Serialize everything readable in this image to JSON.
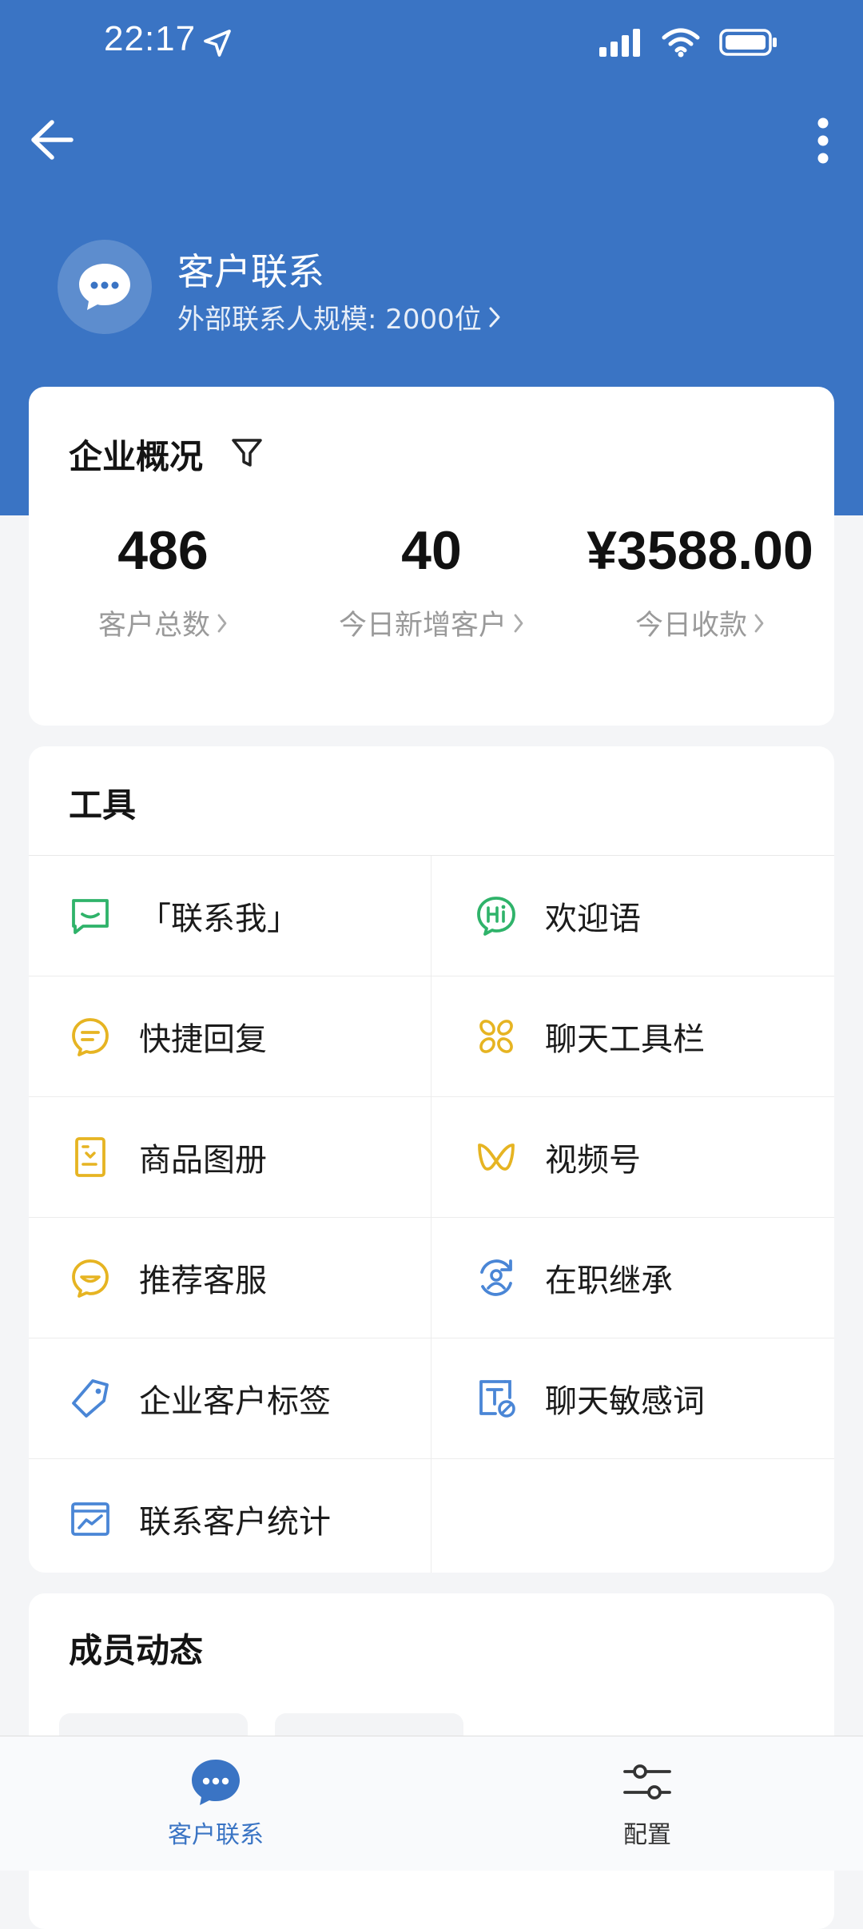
{
  "status_bar": {
    "time": "22:17",
    "icons": [
      "location-arrow-icon",
      "signal-icon",
      "wifi-icon",
      "battery-icon"
    ]
  },
  "header": {
    "app_name": "客户联系",
    "subtitle": "外部联系人规模: 2000位",
    "icons": [
      "back-arrow-icon",
      "more-vertical-icon",
      "chat-bubble-icon"
    ]
  },
  "overview": {
    "title": "企业概况",
    "stats": [
      {
        "value": "486",
        "label": "客户总数"
      },
      {
        "value": "40",
        "label": "今日新增客户"
      },
      {
        "value": "¥3588.00",
        "label": "今日收款"
      }
    ]
  },
  "tools": {
    "title": "工具",
    "items": [
      {
        "label": "「联系我」",
        "icon": "contact-me-icon",
        "color": "#2fb36a"
      },
      {
        "label": "欢迎语",
        "icon": "hi-greeting-icon",
        "color": "#2fb36a"
      },
      {
        "label": "快捷回复",
        "icon": "quick-reply-icon",
        "color": "#e6b422"
      },
      {
        "label": "聊天工具栏",
        "icon": "chat-toolbar-icon",
        "color": "#e6b422"
      },
      {
        "label": "商品图册",
        "icon": "product-album-icon",
        "color": "#e6b422"
      },
      {
        "label": "视频号",
        "icon": "channels-icon",
        "color": "#e6b422"
      },
      {
        "label": "推荐客服",
        "icon": "recommend-service-icon",
        "color": "#e6b422"
      },
      {
        "label": "在职继承",
        "icon": "inheritance-icon",
        "color": "#4a86d6"
      },
      {
        "label": "企业客户标签",
        "icon": "tag-icon",
        "color": "#4a86d6"
      },
      {
        "label": "聊天敏感词",
        "icon": "sensitive-word-icon",
        "color": "#4a86d6"
      },
      {
        "label": "联系客户统计",
        "icon": "statistics-icon",
        "color": "#4a86d6"
      }
    ]
  },
  "members": {
    "title": "成员动态"
  },
  "tabbar": {
    "items": [
      {
        "label": "客户联系",
        "icon": "chat-bubble-icon",
        "active": true
      },
      {
        "label": "配置",
        "icon": "sliders-icon",
        "active": false
      }
    ]
  },
  "colors": {
    "brand_blue": "#3a74c4",
    "green": "#2fb36a",
    "yellow": "#e6b422",
    "icon_blue": "#4a86d6"
  }
}
